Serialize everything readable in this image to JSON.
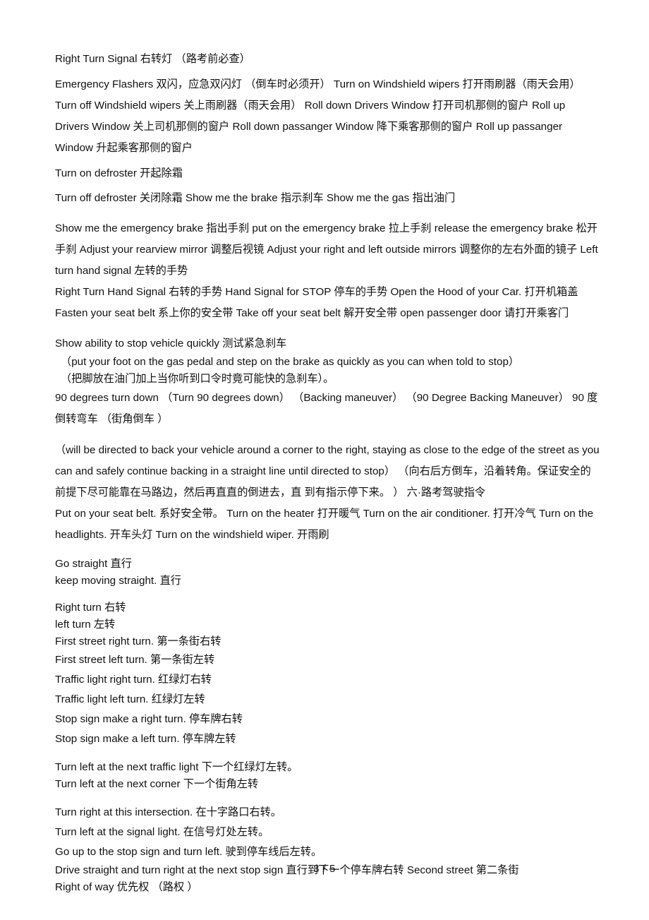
{
  "document": {
    "page_label": "3 / 5",
    "blocks": [
      {
        "id": "b1",
        "text": "Right Turn Signal 右转灯 （路考前必查）"
      },
      {
        "id": "b2",
        "text": "Emergency Flashers 双闪，应急双闪灯 （倒车时必须开） Turn on Windshield wipers 打开雨刷器（雨天会用） Turn off Windshield wipers 关上雨刷器（雨天会用） Roll down Drivers Window 打开司机那侧的窗户 Roll up Drivers Window 关上司机那侧的窗户 Roll down passanger Window 降下乘客那侧的窗户 Roll up passanger Window 升起乘客那侧的窗户"
      },
      {
        "id": "b3",
        "text": "Turn on defroster 开起除霜"
      },
      {
        "id": "b4",
        "text": "Turn off defroster 关闭除霜 Show me the brake 指示刹车 Show me the gas 指出油门"
      },
      {
        "id": "b5",
        "text": "Show me the emergency brake 指出手刹 put on the emergency brake 拉上手刹 release the emergency brake 松开手刹 Adjust your rearview mirror 调整后视镜 Adjust your right and left outside mirrors 调整你的左右外面的镜子 Left turn hand signal 左转的手势"
      },
      {
        "id": "b6",
        "text": "Right Turn Hand Signal 右转的手势 Hand Signal for STOP 停车的手势 Open the Hood of your Car. 打开机箱盖 Fasten your seat belt 系上你的安全带 Take off your seat belt 解开安全带 open passenger door 请打开乘客门"
      },
      {
        "id": "b7",
        "text": "Show ability to stop vehicle quickly 测试紧急刹车"
      },
      {
        "id": "b8",
        "text": "（put your foot on the gas pedal and step on the brake as quickly as you can when told to stop）"
      },
      {
        "id": "b9",
        "text": "（把脚放在油门加上当你听到口令时竟可能快的急刹车）。"
      },
      {
        "id": "b10",
        "text": "90 degrees turn down （Turn 90 degrees down） （Backing maneuver） （90 Degree Backing Maneuver） 90 度倒转弯车 （街角倒车 ）"
      },
      {
        "id": "b11",
        "text": "（will be directed to back your vehicle around a corner to the right, staying as close to the edge of the street as you can and safely continue backing in a straight line until directed to stop） （向右后方倒车，沿着转角。保证安全的前提下尽可能靠在马路边，然后再直直的倒进去，直 到有指示停下来。 ） 六·路考驾驶指令"
      },
      {
        "id": "b12",
        "text": "Put on your seat belt. 系好安全带。 Turn on the heater 打开暖气 Turn on the air conditioner. 打开冷气 Turn on the headlights. 开车头灯 Turn on the windshield wiper. 开雨刷"
      },
      {
        "id": "b13",
        "text": "Go straight 直行"
      },
      {
        "id": "b14",
        "text": "keep moving straight. 直行"
      },
      {
        "id": "b15",
        "text": "Right turn 右转"
      },
      {
        "id": "b16",
        "text": "left turn 左转"
      },
      {
        "id": "b17",
        "text": "First street right turn. 第一条街右转"
      },
      {
        "id": "b18",
        "text": "First street left turn. 第一条街左转"
      },
      {
        "id": "b19",
        "text": "Traffic light right turn. 红绿灯右转"
      },
      {
        "id": "b20",
        "text": "Traffic light left turn. 红绿灯左转"
      },
      {
        "id": "b21",
        "text": "Stop sign make a right turn. 停车牌右转"
      },
      {
        "id": "b22",
        "text": "Stop sign make a left turn. 停车牌左转"
      },
      {
        "id": "b23",
        "text": "Turn left at the next traffic light 下一个红绿灯左转。"
      },
      {
        "id": "b24",
        "text": "Turn left at the next corner 下一个街角左转"
      },
      {
        "id": "b25",
        "text": "Turn right at this intersection. 在十字路口右转。"
      },
      {
        "id": "b26",
        "text": "Turn left at the signal light. 在信号灯处左转。"
      },
      {
        "id": "b27",
        "text": "Go up to the stop sign and turn left. 驶到停车线后左转。"
      },
      {
        "id": "b28",
        "text": "Drive straight and turn right at the next stop sign 直行到下一个停车牌右转 Second street 第二条街"
      },
      {
        "id": "b29",
        "text": "Right of way 优先权 （路权 ）"
      }
    ]
  }
}
